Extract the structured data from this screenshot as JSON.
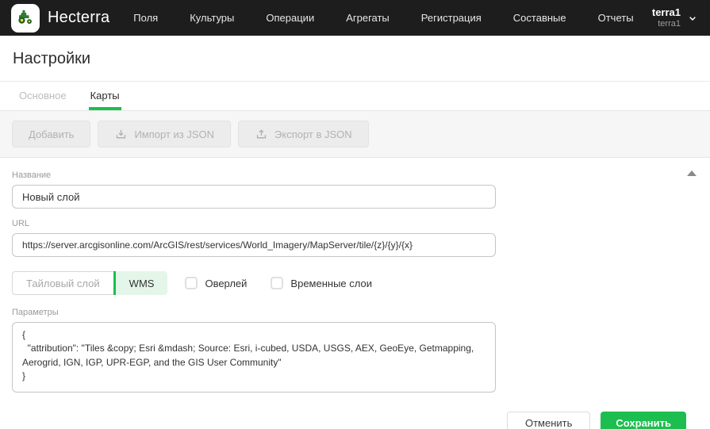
{
  "accent_color": "#1cbe4f",
  "header": {
    "brand": "Hecterra",
    "nav_items": [
      {
        "label": "Поля"
      },
      {
        "label": "Культуры"
      },
      {
        "label": "Операции"
      },
      {
        "label": "Агрегаты"
      },
      {
        "label": "Регистрация"
      },
      {
        "label": "Составные"
      },
      {
        "label": "Отчеты"
      }
    ],
    "user": {
      "name": "terra1",
      "account": "terra1"
    }
  },
  "page": {
    "title": "Настройки"
  },
  "tabs": [
    {
      "label": "Основное",
      "active": false
    },
    {
      "label": "Карты",
      "active": true
    }
  ],
  "toolbar": {
    "add_label": "Добавить",
    "import_label": "Импорт из JSON",
    "export_label": "Экспорт в JSON"
  },
  "form": {
    "name_label": "Название",
    "name_value": "Новый слой",
    "url_label": "URL",
    "url_value": "https://server.arcgisonline.com/ArcGIS/rest/services/World_Imagery/MapServer/tile/{z}/{y}/{x}",
    "layer_type": {
      "options": [
        "Тайловый слой",
        "WMS"
      ],
      "selected": "WMS"
    },
    "checkboxes": [
      {
        "label": "Оверлей",
        "checked": false
      },
      {
        "label": "Временные слои",
        "checked": false
      }
    ],
    "params_label": "Параметры",
    "params_value": "{\n  \"attribution\": \"Tiles &copy; Esri &mdash; Source: Esri, i-cubed, USDA, USGS, AEX, GeoEye, Getmapping, Aerogrid, IGN, IGP, UPR-EGP, and the GIS User Community\"\n}"
  },
  "footer": {
    "cancel_label": "Отменить",
    "save_label": "Сохранить"
  }
}
